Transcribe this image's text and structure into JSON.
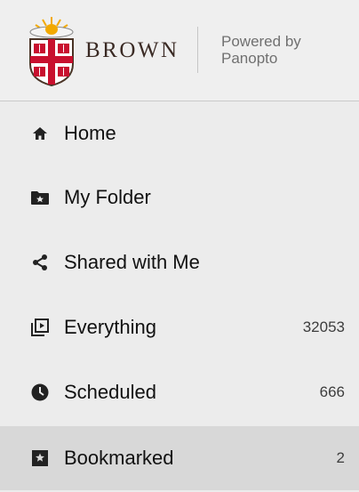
{
  "header": {
    "brand_name": "BROWN",
    "powered_line1": "Powered by",
    "powered_line2": "Panopto"
  },
  "nav": {
    "items": [
      {
        "label": "Home",
        "icon": "home-icon",
        "count": ""
      },
      {
        "label": "My Folder",
        "icon": "folder-star-icon",
        "count": ""
      },
      {
        "label": "Shared with Me",
        "icon": "share-icon",
        "count": ""
      },
      {
        "label": "Everything",
        "icon": "everything-icon",
        "count": "32053"
      },
      {
        "label": "Scheduled",
        "icon": "clock-icon",
        "count": "666"
      },
      {
        "label": "Bookmarked",
        "icon": "bookmark-icon",
        "count": "2",
        "selected": true
      }
    ]
  },
  "colors": {
    "sidebar_bg": "#ececec",
    "selected_bg": "#d8d8d8",
    "header_bg": "#efefef",
    "brown_red": "#c8102e",
    "text": "#111111",
    "muted": "#707070"
  }
}
